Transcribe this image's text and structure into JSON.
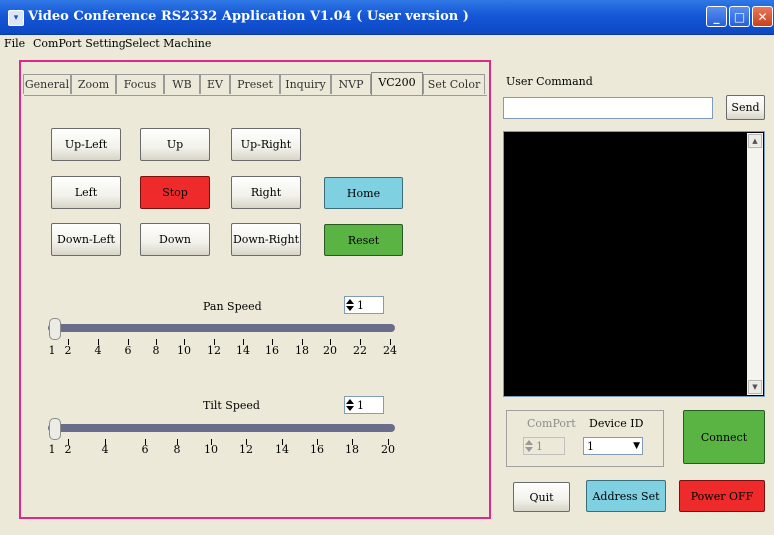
{
  "window": {
    "title": "Video Conference RS2332 Application V1.04 ( User version )",
    "icon": "app-icon"
  },
  "menu": [
    "File",
    "ComPort Setting",
    "Select Machine"
  ],
  "tabs": [
    "General",
    "Zoom",
    "Focus",
    "WB",
    "EV",
    "Preset",
    "Inquiry",
    "NVP",
    "VC200",
    "Set Color"
  ],
  "active_tab": "VC200",
  "ptz": {
    "up_left": "Up-Left",
    "up": "Up",
    "up_right": "Up-Right",
    "left": "Left",
    "stop": "Stop",
    "right": "Right",
    "home": "Home",
    "down_left": "Down-Left",
    "down": "Down",
    "down_right": "Down-Right",
    "reset": "Reset"
  },
  "pan": {
    "label": "Pan Speed",
    "value": "1",
    "ticks": [
      "1",
      "2",
      "4",
      "6",
      "8",
      "10",
      "12",
      "14",
      "16",
      "18",
      "20",
      "22",
      "24"
    ]
  },
  "tilt": {
    "label": "Tilt Speed",
    "value": "1",
    "ticks": [
      "1",
      "2",
      "4",
      "6",
      "8",
      "10",
      "12",
      "14",
      "16",
      "18",
      "20"
    ]
  },
  "user_command": {
    "label": "User Command",
    "value": "",
    "send": "Send"
  },
  "comport": {
    "label": "ComPort",
    "value": "1",
    "device_label": "Device ID",
    "device_value": "1"
  },
  "buttons": {
    "connect": "Connect",
    "quit": "Quit",
    "address_set": "Address Set",
    "power_off": "Power OFF"
  },
  "colors": {
    "stop": "#ee2a2a",
    "home": "#7fd0e0",
    "reset": "#5ab444",
    "connect": "#5ab444",
    "address_set": "#7fd0e0",
    "power_off": "#ee2a2a",
    "highlight_border": "#e0288c",
    "title_bar": "#1657d6"
  }
}
